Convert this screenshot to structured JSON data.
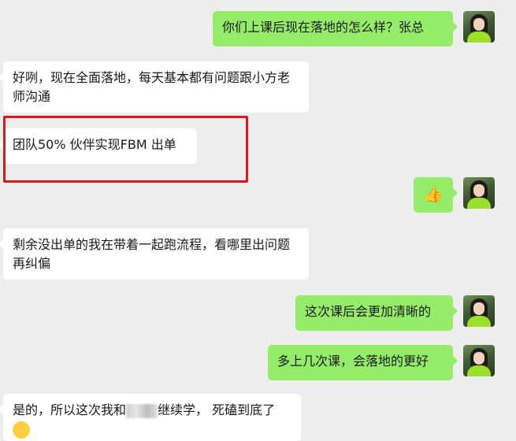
{
  "messages": [
    {
      "side": "out",
      "text": "你们上课后现在落地的怎么样？张总"
    },
    {
      "side": "in",
      "text": "好咧，现在全面落地，每天基本都有问题跟小方老师沟通"
    },
    {
      "side": "in",
      "text": "团队50% 伙伴实现FBM 出单"
    },
    {
      "side": "out",
      "emoji": "👍"
    },
    {
      "side": "in",
      "text": "剩余没出单的我在带着一起跑流程，看哪里出问题再纠偏"
    },
    {
      "side": "out",
      "text": "这次课后会更加清晰的"
    },
    {
      "side": "out",
      "text": "多上几次课，会落地的更好"
    },
    {
      "side": "in",
      "text_before": "是的，所以这次我和",
      "text_after": "继续学， 死磕到底了"
    }
  ],
  "colors": {
    "background": "#ededed",
    "incoming_bubble": "#ffffff",
    "outgoing_bubble": "#95ec69",
    "highlight": "#e0161d"
  },
  "icons": {
    "avatar": "avatar-woman-green-shirt",
    "thumbs_up": "thumbs-up-emoji",
    "partial_emoji": "smile-emoji"
  }
}
